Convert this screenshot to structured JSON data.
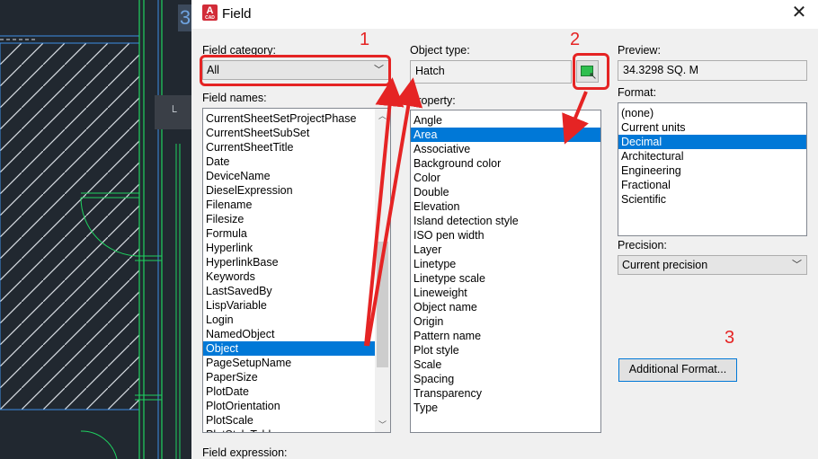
{
  "canvas": {
    "label": "3"
  },
  "dialog": {
    "title": "Field",
    "app_icon_letter": "A",
    "app_icon_caption": "CAD",
    "close_glyph": "✕"
  },
  "field_category": {
    "label": "Field category:",
    "value": "All"
  },
  "field_names": {
    "label": "Field names:",
    "items": [
      "CurrentSheetSetProjectPhase",
      "CurrentSheetSubSet",
      "CurrentSheetTitle",
      "Date",
      "DeviceName",
      "DieselExpression",
      "Filename",
      "Filesize",
      "Formula",
      "Hyperlink",
      "HyperlinkBase",
      "Keywords",
      "LastSavedBy",
      "LispVariable",
      "Login",
      "NamedObject",
      "Object",
      "PageSetupName",
      "PaperSize",
      "PlotDate",
      "PlotOrientation",
      "PlotScale",
      "PlotStyleTable"
    ],
    "selected": "Object"
  },
  "object_type": {
    "label": "Object type:",
    "value": "Hatch",
    "pick_button_icon": "select-objects-icon"
  },
  "property": {
    "label": "Property:",
    "items": [
      "Angle",
      "Area",
      "Associative",
      "Background color",
      "Color",
      "Double",
      "Elevation",
      "Island detection style",
      "ISO pen width",
      "Layer",
      "Linetype",
      "Linetype scale",
      "Lineweight",
      "Object name",
      "Origin",
      "Pattern name",
      "Plot style",
      "Scale",
      "Spacing",
      "Transparency",
      "Type"
    ],
    "selected": "Area"
  },
  "preview": {
    "label": "Preview:",
    "value": "34.3298 SQ. M"
  },
  "format": {
    "label": "Format:",
    "items": [
      "(none)",
      "Current units",
      "Decimal",
      "Architectural",
      "Engineering",
      "Fractional",
      "Scientific"
    ],
    "selected": "Decimal"
  },
  "precision": {
    "label": "Precision:",
    "value": "Current precision"
  },
  "additional_format_button": "Additional Format...",
  "field_expression": {
    "label": "Field expression:"
  },
  "annotations": {
    "step1": "1",
    "step2": "2",
    "step3": "3",
    "color": "#e52424"
  },
  "colors": {
    "selection": "#0078d7",
    "accent_red": "#e52424",
    "cad_background": "#212830",
    "cad_green": "#1fd260"
  }
}
